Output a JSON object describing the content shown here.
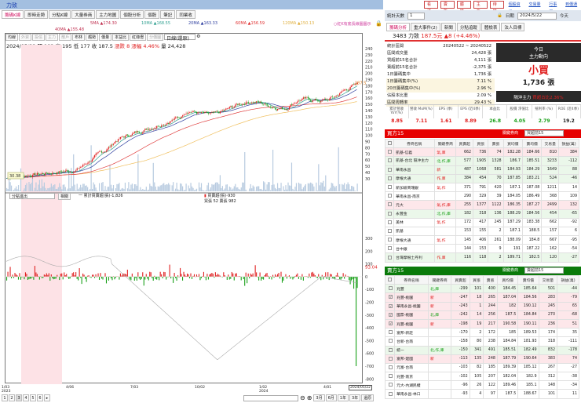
{
  "window": {
    "title": "力致"
  },
  "tabs": [
    "籌碼K線",
    "即時走勢",
    "分點K線",
    "大量券商",
    "主力地圖",
    "個股分析",
    "個股",
    "筆記",
    "同業收"
  ],
  "ma": {
    "5MA": "5MA ▲174.30",
    "10MA": "10MA ▲168.55",
    "20MA": "20MA ▲163.33",
    "60MA": "60MA ▲156.59",
    "120MA": "120MA ▲150.13",
    "40MA": "40MA ▲155.48",
    "note": "○紅K有底長線圖圖示"
  },
  "toolbar": {
    "buttons": [
      "均線",
      "外資",
      "投信",
      "主力",
      "散戶",
      "布林",
      "趨勢",
      "價量",
      "本益比",
      "紅綠燈",
      "分價圖"
    ],
    "period": "日線(還原)"
  },
  "price_info": {
    "date": "2024/05/22",
    "open": "開 182",
    "high": "高 195",
    "low": "低 177",
    "close": "收 187.5",
    "change": "漲跌 8",
    "pct": "漲幅 4.46%",
    "volume": "量 24,428"
  },
  "price_axis": [
    "240",
    "230",
    "220",
    "210",
    "200",
    "190",
    "180",
    "170",
    "160",
    "150",
    "140",
    "130",
    "120",
    "110",
    "100",
    "90",
    "80",
    "70",
    "60",
    "50",
    "40",
    "30"
  ],
  "last_price_label": "187.5",
  "low_label": "30.38",
  "lower": {
    "select": "分點進出",
    "button": "相關",
    "legend1": "一 累計買賣超(張)-1,826",
    "legend2": "買賣超(張)-930",
    "legend3": "買張 52 賣張 982",
    "axis": [
      "300",
      "200",
      "100",
      "0",
      "-100",
      "-200",
      "-300",
      "-400",
      "-500",
      "-600",
      "-700",
      "-800",
      "-900",
      "-1000"
    ],
    "value_label": "93.04"
  },
  "dates": [
    {
      "d": "1/03",
      "y": "2023"
    },
    {
      "d": "4/06",
      "y": ""
    },
    {
      "d": "7/03",
      "y": ""
    },
    {
      "d": "10/02",
      "y": ""
    },
    {
      "d": "1/02",
      "y": "2024"
    },
    {
      "d": "4/01",
      "y": ""
    }
  ],
  "current_date": "2024/05/22",
  "pager": [
    "1",
    "2",
    "3",
    "4",
    "5",
    "6",
    "▸"
  ],
  "range_buttons": [
    "3月",
    "6月",
    "1年",
    "3年",
    "還原"
  ],
  "right_top": {
    "buttons": [
      "看漲",
      "賣盤",
      "體檢",
      "主力",
      "待檢"
    ],
    "links": [
      "個股資訊",
      "交易量比",
      "行事曆",
      "到價通知"
    ]
  },
  "days": {
    "label": "統計天數",
    "value": "1",
    "date_label": "日期",
    "date": "2024/5/22",
    "today": "今天"
  },
  "right_tabs": [
    "籌碼分析",
    "重大事件(2)",
    "新聞",
    "分點追蹤",
    "體檢表",
    "法人目標"
  ],
  "stock": {
    "code_name": "3483 力致",
    "price": "187.5元",
    "change": "▲8 (+4.46%)"
  },
  "stats": [
    {
      "k": "統計區間",
      "v": "20240522 ~ 20240522"
    },
    {
      "k": "區間成交量",
      "v": "24,428 張"
    },
    {
      "k": "買超前15名合計",
      "v": "4,111 張"
    },
    {
      "k": "賣超前15名合計",
      "v": "-2,375 張"
    },
    {
      "k": "1日籌碼集中",
      "v": "1,736 張"
    },
    {
      "k": "1日籌碼集中(%)",
      "v": "7.11 %"
    },
    {
      "k": "20日籌碼集中(%)",
      "v": "2.96 %"
    },
    {
      "k": "佔股本比重",
      "v": "2.09 %"
    },
    {
      "k": "區間周轉率",
      "v": "29.43 %"
    }
  ],
  "today": {
    "t1": "今日",
    "t2": "主力動向",
    "action": "小買",
    "amount": "1,736 張",
    "footer": "隔沖主力",
    "footer_val": "買超占比2.36%"
  },
  "metrics": [
    {
      "h": "累計營收 YoY(%)",
      "v": "8.85",
      "c": "#e02020"
    },
    {
      "h": "營收 MoM(%)",
      "v": "7.11",
      "c": "#e02020"
    },
    {
      "h": "EPS (季)",
      "v": "1.61",
      "c": "#e02020"
    },
    {
      "h": "EPS (近4季)",
      "v": "8.89",
      "c": "#e02020"
    },
    {
      "h": "本益比",
      "v": "26.8",
      "c": "#18a018"
    },
    {
      "h": "股價 淨值比",
      "v": "4.05",
      "c": "#18a018"
    },
    {
      "h": "殖利率 (%)",
      "v": "2.79",
      "c": "#18a018"
    },
    {
      "h": "ROE (近4季)",
      "v": "19.2",
      "c": "#222"
    }
  ],
  "buy_table": {
    "title": "買方15",
    "filter_label": "關鍵券商",
    "filter": "買超前15",
    "headers": [
      "券商名稱",
      "關鍵券商",
      "買賣超",
      "買張",
      "賣張",
      "買均價",
      "賣均價",
      "交易量",
      "損益(萬)"
    ],
    "rows": [
      [
        "凱基-信義",
        "氣,庫",
        "662",
        "736",
        "74",
        "182.28",
        "184.66",
        "810",
        "384",
        "pink"
      ],
      [
        "凱基-台北 隔沖主力",
        "北,作,庫",
        "577",
        "1905",
        "1328",
        "186.7",
        "185.51",
        "3233",
        "-112",
        "lg"
      ],
      [
        "華南永昌",
        "新",
        "487",
        "1068",
        "581",
        "184.93",
        "184.29",
        "1649",
        "88",
        "lg"
      ],
      [
        "摩根大通",
        "作,庫",
        "384",
        "454",
        "70",
        "187.85",
        "183.21",
        "524",
        "-46",
        "lg"
      ],
      [
        "新加坡商瑞銀",
        "氣,作",
        "371",
        "791",
        "420",
        "187.1",
        "187.08",
        "1211",
        "14",
        ""
      ],
      [
        "華南永昌-南京",
        "",
        "290",
        "329",
        "39",
        "184.05",
        "186.49",
        "368",
        "109",
        ""
      ],
      [
        "元大",
        "氣,作,庫",
        "255",
        "1377",
        "1122",
        "186.35",
        "187.27",
        "2499",
        "132",
        "pink"
      ],
      [
        "永豐金",
        "北,作,庫",
        "182",
        "318",
        "136",
        "188.29",
        "184.56",
        "454",
        "-65",
        "lg"
      ],
      [
        "美林",
        "氣,作",
        "172",
        "417",
        "245",
        "187.29",
        "183.38",
        "662",
        "-92",
        ""
      ],
      [
        "凱基",
        "",
        "153",
        "155",
        "2",
        "187.1",
        "188.5",
        "157",
        "6",
        ""
      ],
      [
        "摩根大通",
        "氣,作",
        "145",
        "406",
        "261",
        "188.09",
        "184.8",
        "667",
        "-95",
        ""
      ],
      [
        "台中銀",
        "",
        "144",
        "153",
        "9",
        "191",
        "187.22",
        "162",
        "-54",
        ""
      ],
      [
        "台灣摩根士丹利",
        "作,庫",
        "116",
        "118",
        "2",
        "189.71",
        "182.5",
        "120",
        "-27",
        "lg"
      ]
    ]
  },
  "sell_table": {
    "title": "賣方15",
    "filter_label": "關鍵券商",
    "filter": "賣超前15",
    "headers": [
      "券商名稱",
      "關鍵券商",
      "買賣超",
      "買張",
      "賣張",
      "買均價",
      "賣均價",
      "交易量",
      "損益(萬)"
    ],
    "rows": [
      [
        "兆豐",
        "北,庫",
        "-299",
        "101",
        "400",
        "184.45",
        "185.64",
        "501",
        "-44",
        "lg",
        ""
      ],
      [
        "兆豐-桃園",
        "新",
        "-247",
        "18",
        "265",
        "187.04",
        "184.56",
        "283",
        "-79",
        "pink",
        "✓"
      ],
      [
        "華南永昌-桃園",
        "新",
        "-243",
        "1",
        "244",
        "182",
        "190.12",
        "245",
        "65",
        "pink",
        "✓"
      ],
      [
        "國票-桃園",
        "北,庫",
        "-242",
        "14",
        "256",
        "187.5",
        "184.84",
        "270",
        "-68",
        "pink",
        "✓"
      ],
      [
        "兆豐-桃園",
        "新",
        "-198",
        "19",
        "217",
        "190.58",
        "190.11",
        "236",
        "51",
        "pink",
        "✓"
      ],
      [
        "富邦-新莊",
        "",
        "-170",
        "2",
        "172",
        "185",
        "189.53",
        "174",
        "35",
        "",
        ""
      ],
      [
        "台新-台南",
        "",
        "-158",
        "80",
        "238",
        "184.84",
        "181.93",
        "318",
        "-111",
        "",
        ""
      ],
      [
        "統一",
        "北,作,庫",
        "-150",
        "341",
        "491",
        "185.51",
        "182.49",
        "832",
        "-178",
        "lg",
        ""
      ],
      [
        "富邦-建國",
        "新",
        "-113",
        "135",
        "248",
        "187.79",
        "190.64",
        "383",
        "74",
        "pink",
        ""
      ],
      [
        "元富-台南",
        "",
        "-103",
        "82",
        "185",
        "189.39",
        "185.12",
        "267",
        "-27",
        "",
        ""
      ],
      [
        "兆豐-南京",
        "",
        "-102",
        "105",
        "207",
        "182.04",
        "182.9",
        "312",
        "-38",
        "",
        ""
      ],
      [
        "元大-內湖民權",
        "",
        "-96",
        "26",
        "122",
        "189.46",
        "185.1",
        "148",
        "-34",
        "",
        ""
      ],
      [
        "華南永昌-林口",
        "",
        "-93",
        "4",
        "97",
        "187.5",
        "188.67",
        "101",
        "11",
        "",
        ""
      ]
    ]
  },
  "colors": {
    "up": "#e02020",
    "down": "#18a018",
    "buy_header": "#e60000",
    "sell_header": "#0a7a0a"
  }
}
